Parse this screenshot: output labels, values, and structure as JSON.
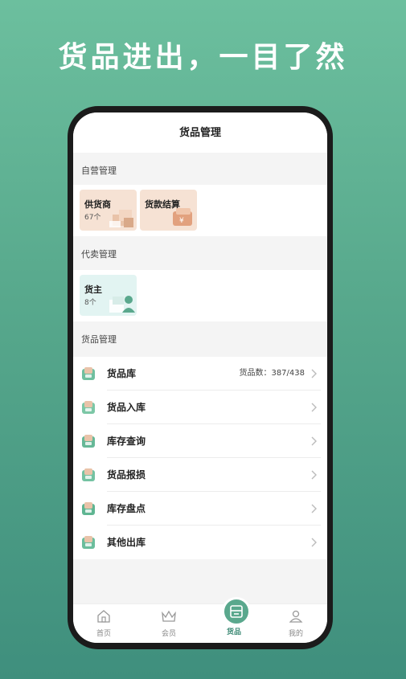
{
  "headline": "货品进出，一目了然",
  "header": {
    "title": "货品管理"
  },
  "self_operated": {
    "title": "自营管理",
    "cards": [
      {
        "title": "供货商",
        "sub": "67个"
      },
      {
        "title": "货款结算"
      }
    ]
  },
  "consignment": {
    "title": "代卖管理",
    "cards": [
      {
        "title": "货主",
        "sub": "8个"
      }
    ]
  },
  "goods": {
    "title": "货品管理",
    "items": [
      {
        "label": "货品库",
        "count": "货品数：387/438",
        "icon": "warehouse-icon"
      },
      {
        "label": "货品入库",
        "icon": "inbound-icon"
      },
      {
        "label": "库存查询",
        "icon": "inventory-search-icon"
      },
      {
        "label": "货品报损",
        "icon": "damage-report-icon"
      },
      {
        "label": "库存盘点",
        "icon": "stocktake-icon"
      },
      {
        "label": "其他出库",
        "icon": "outbound-icon"
      }
    ]
  },
  "tabs": [
    {
      "label": "首页",
      "icon": "home-icon"
    },
    {
      "label": "会员",
      "icon": "crown-icon"
    },
    {
      "label": "货品",
      "icon": "goods-icon",
      "active": true
    },
    {
      "label": "我的",
      "icon": "profile-icon"
    }
  ],
  "colors": {
    "accent": "#3e8b76",
    "card_peach": "#f6e2d4",
    "card_mint": "#e2f4f2",
    "bg_green": "#57a88c"
  }
}
